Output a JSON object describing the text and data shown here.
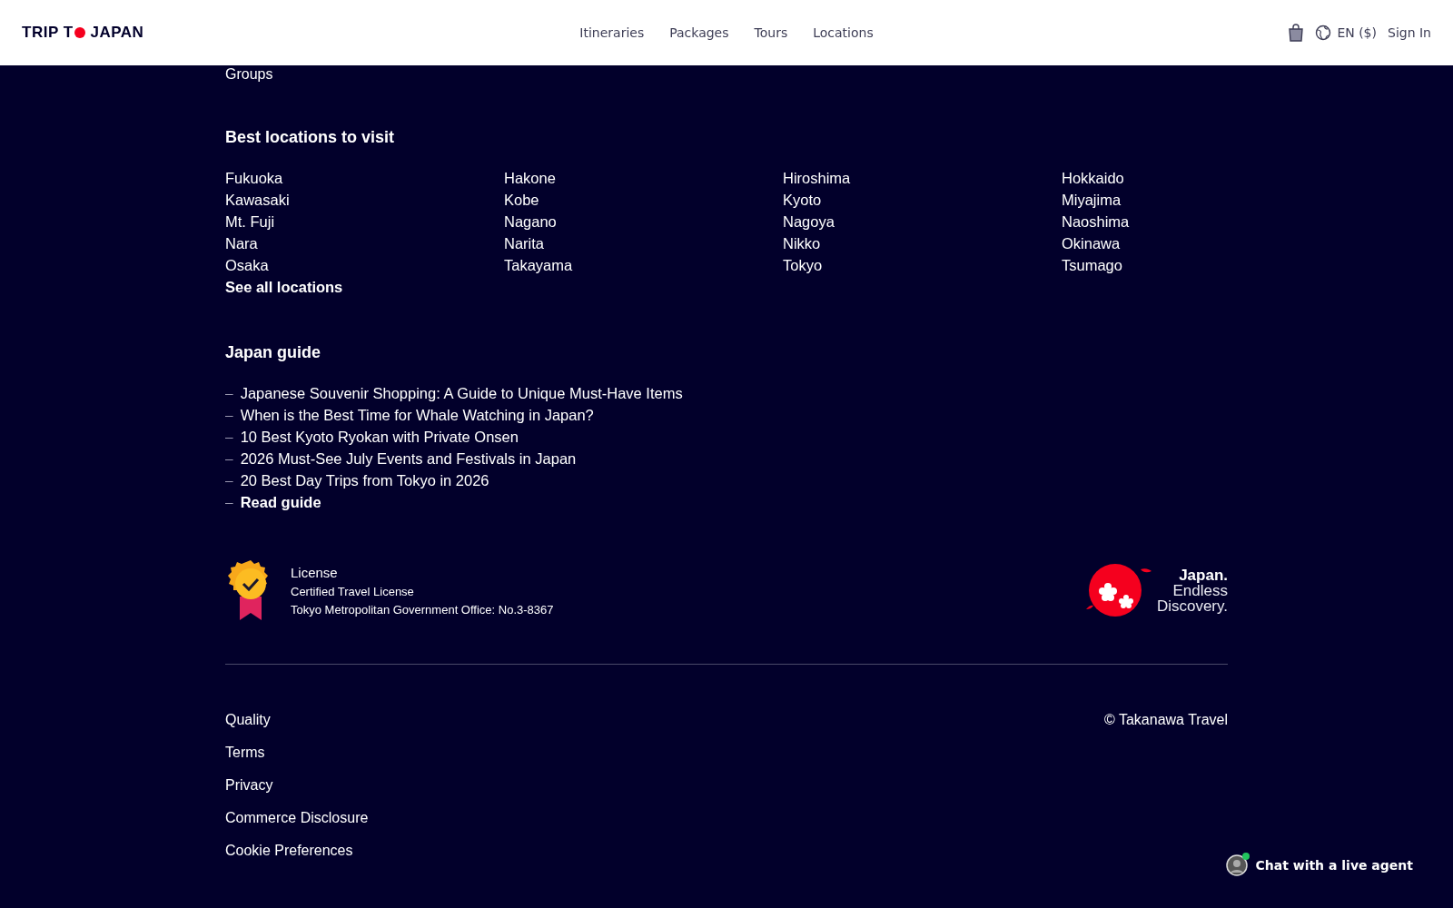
{
  "header": {
    "logo": {
      "before": "TRIP T",
      "after": "JAPAN"
    },
    "nav": [
      "Itineraries",
      "Packages",
      "Tours",
      "Locations"
    ],
    "language": "EN ($)",
    "sign_in": "Sign In"
  },
  "cut_link": "Groups",
  "locations": {
    "title": "Best locations to visit",
    "items": [
      "Fukuoka",
      "Hakone",
      "Hiroshima",
      "Hokkaido",
      "Kawasaki",
      "Kobe",
      "Kyoto",
      "Miyajima",
      "Mt. Fuji",
      "Nagano",
      "Nagoya",
      "Naoshima",
      "Nara",
      "Narita",
      "Nikko",
      "Okinawa",
      "Osaka",
      "Takayama",
      "Tokyo",
      "Tsumago"
    ],
    "see_all": "See all locations"
  },
  "guide": {
    "title": "Japan guide",
    "dash": "–",
    "articles": [
      "Japanese Souvenir Shopping: A Guide to Unique Must-Have Items",
      "When is the Best Time for Whale Watching in Japan?",
      "10 Best Kyoto Ryokan with Private Onsen",
      "2026 Must-See July Events and Festivals in Japan",
      "20 Best Day Trips from Tokyo in 2026"
    ],
    "read_more": "Read guide"
  },
  "license": {
    "title": "License",
    "lines": [
      "Certified Travel License",
      "Tokyo Metropolitan Government Office: No.3-8367"
    ]
  },
  "brand": {
    "title": "Japan.",
    "lines": [
      "Endless",
      "Discovery."
    ]
  },
  "footer_links": [
    "Quality",
    "Terms",
    "Privacy",
    "Commerce Disclosure",
    "Cookie Preferences"
  ],
  "copyright": "© Takanawa Travel",
  "chat": {
    "label": "Chat with a live agent",
    "online": true
  }
}
